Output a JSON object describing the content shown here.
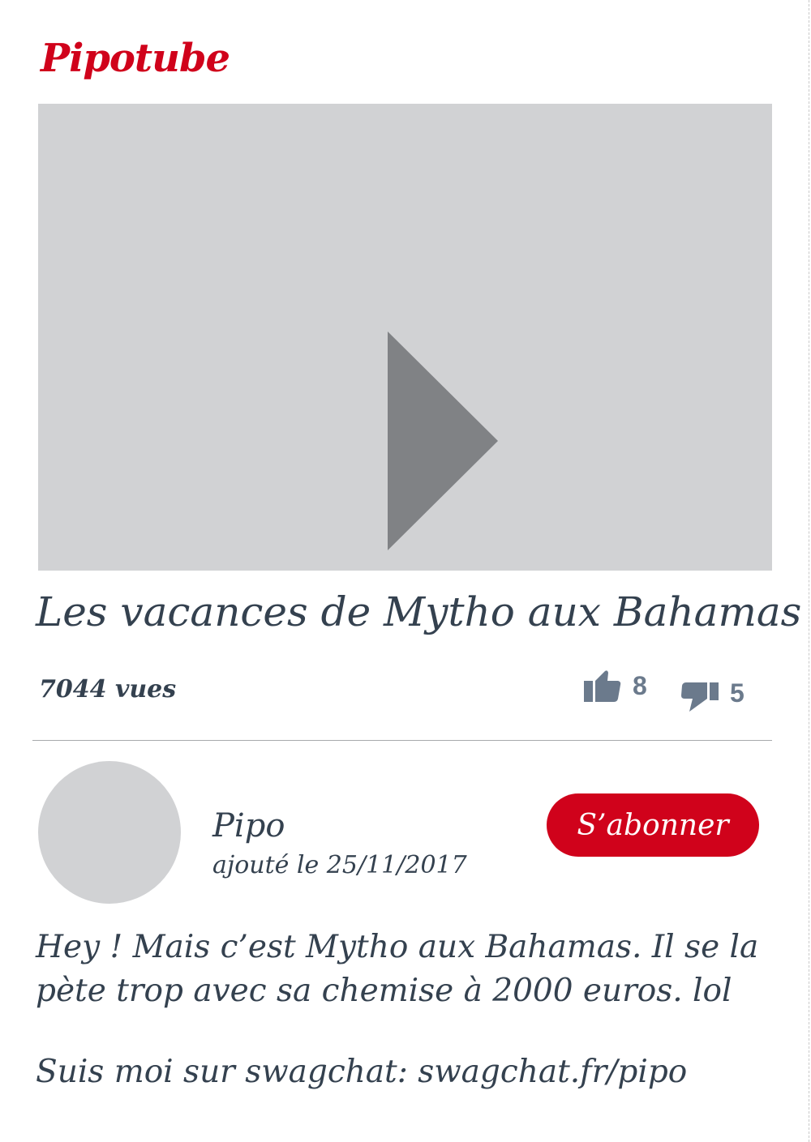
{
  "app": {
    "brand": "Pipotube",
    "accent_color": "#d0021b",
    "text_color": "#34414f"
  },
  "video": {
    "player_state": "paused",
    "play_icon": "play-icon",
    "title": "Les vacances de Mytho aux Bahamas",
    "views": "7044 vues",
    "likes": "8",
    "dislikes": "5",
    "like_icon": "thumbs-up-icon",
    "dislike_icon": "thumbs-down-icon"
  },
  "channel": {
    "name": "Pipo",
    "upload_date": "ajouté le 25/11/2017",
    "subscribe_label": "S’abonner"
  },
  "description": {
    "text": "Hey ! Mais c’est Mytho aux Bahamas. Il se la pète trop avec sa chemise à 2000 euros. lol",
    "follow_prefix": "Suis moi sur swagchat: ",
    "follow_link": "swagchat.fr/pipo"
  }
}
